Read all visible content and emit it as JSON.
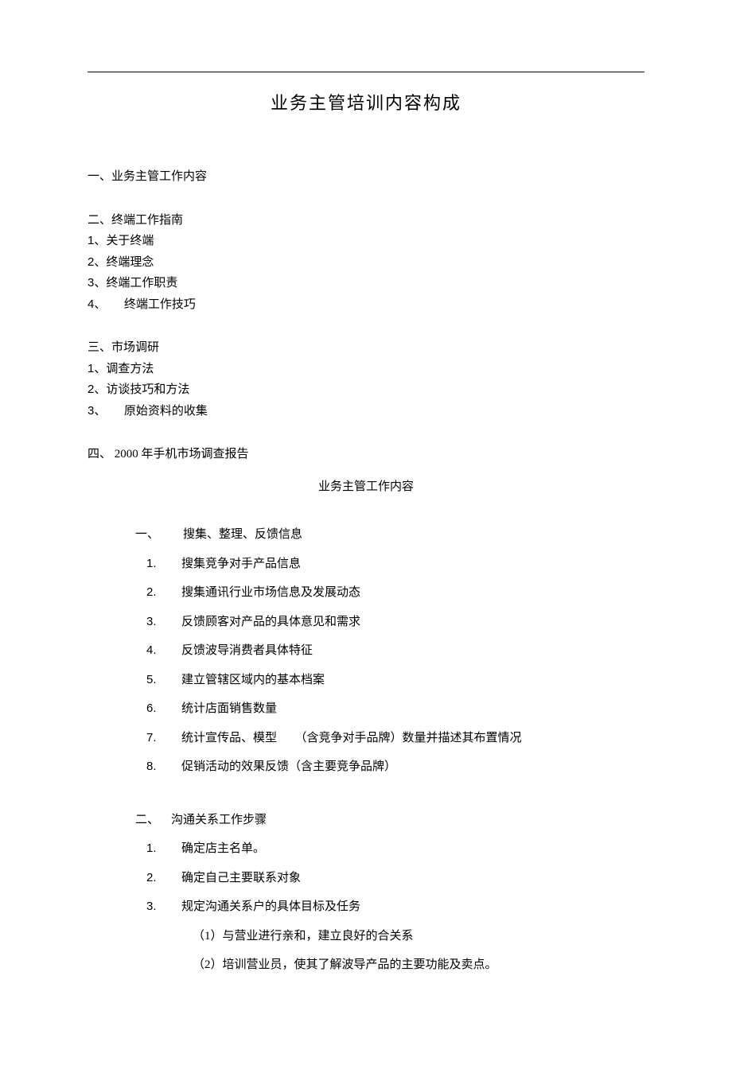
{
  "title": "业务主管培训内容构成",
  "outline": {
    "s1": {
      "head": "一、业务主管工作内容"
    },
    "s2": {
      "head": "二、终端工作指南",
      "i1": {
        "num": "1、",
        "text": "关于终端"
      },
      "i2": {
        "num": "2、",
        "text": "终端理念"
      },
      "i3": {
        "num": "3、",
        "text": "终端工作职责"
      },
      "i4": {
        "num": "4、",
        "text": "　　终端工作技巧"
      }
    },
    "s3": {
      "head": "三、市场调研",
      "i1": {
        "num": "1、",
        "text": "调查方法"
      },
      "i2": {
        "num": "2、",
        "text": "访谈技巧和方法"
      },
      "i3": {
        "num": "3、",
        "text": "　　原始资料的收集"
      }
    },
    "s4": {
      "head": "四、 2000 年手机市场调查报告"
    }
  },
  "subtitle": "业务主管工作内容",
  "detail": {
    "g1": {
      "head": {
        "cnum": "一、",
        "text": "　　搜集、整理、反馈信息"
      },
      "i1": {
        "num": "1.",
        "text": "搜集竞争对手产品信息"
      },
      "i2": {
        "num": "2.",
        "text": "搜集通讯行业市场信息及发展动态"
      },
      "i3": {
        "num": "3.",
        "text": "反馈顾客对产品的具体意见和需求"
      },
      "i4": {
        "num": "4.",
        "text": "反馈波导消费者具体特征"
      },
      "i5": {
        "num": "5.",
        "text": "建立管辖区域内的基本档案"
      },
      "i6": {
        "num": "6.",
        "text": "统计店面销售数量"
      },
      "i7": {
        "num": "7.",
        "text": "统计宣传品、模型　　（含竞争对手品牌）数量并描述其布置情况"
      },
      "i8": {
        "num": "8.",
        "text": "促销活动的效果反馈（含主要竞争品牌）"
      }
    },
    "g2": {
      "head": {
        "cnum": "二、",
        "text": "　沟通关系工作步骤"
      },
      "i1": {
        "num": "1.",
        "text": "确定店主名单。"
      },
      "i2": {
        "num": "2.",
        "text": "确定自己主要联系对象"
      },
      "i3": {
        "num": "3.",
        "text": "规定沟通关系户的具体目标及任务"
      },
      "sub1": "（1）与营业进行亲和，建立良好的合关系",
      "sub2": "（2）培训营业员，使其了解波导产品的主要功能及卖点。"
    }
  }
}
